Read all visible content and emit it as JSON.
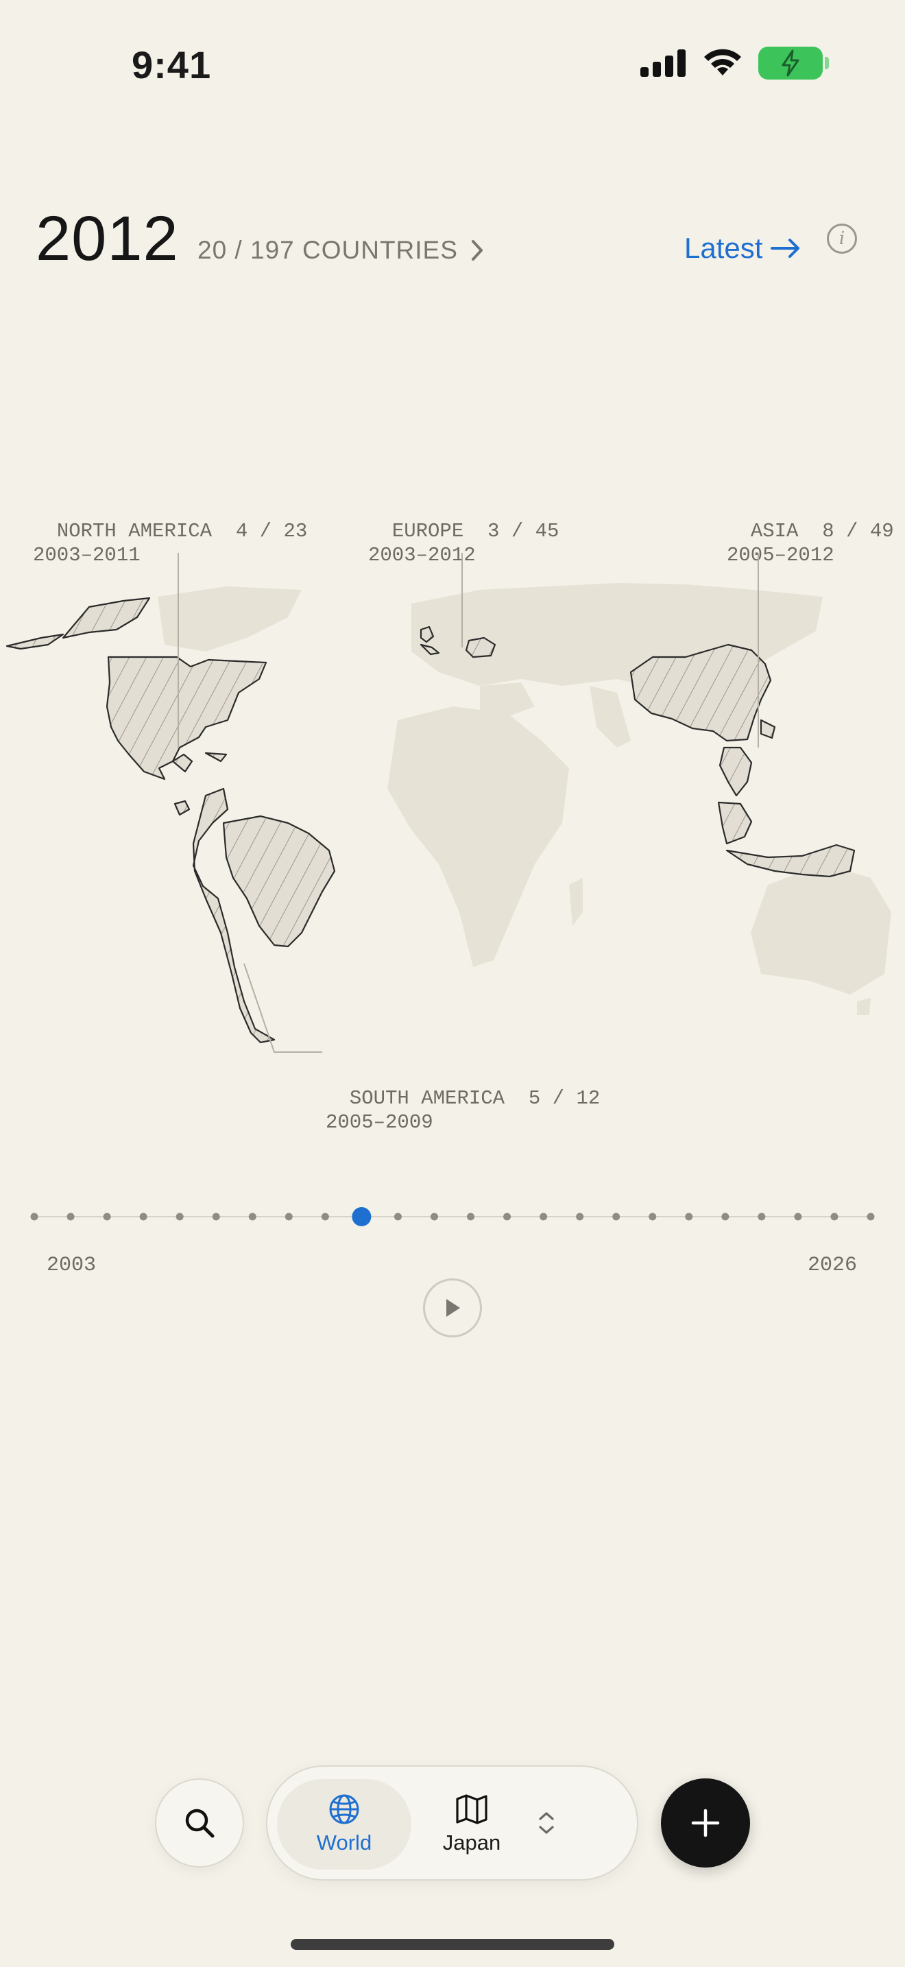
{
  "status": {
    "time": "9:41"
  },
  "header": {
    "year": "2012",
    "countries": "20 / 197 COUNTRIES",
    "latest_label": "Latest"
  },
  "regions": {
    "north_america": {
      "name": "NORTH AMERICA",
      "count": "4 / 23",
      "range": "2003–2011"
    },
    "europe": {
      "name": "EUROPE",
      "count": "3 / 45",
      "range": "2003–2012"
    },
    "asia": {
      "name": "ASIA",
      "count": "8 / 49",
      "range": "2005–2012"
    },
    "south_america": {
      "name": "SOUTH AMERICA",
      "count": "5 / 12",
      "range": "2005–2009"
    }
  },
  "timeline": {
    "start_label": "2003",
    "end_label": "2026",
    "start_year": 2003,
    "end_year": 2026,
    "selected_year": 2012,
    "accent": "#1e6fd0"
  },
  "tabbar": {
    "world_label": "World",
    "japan_label": "Japan",
    "search_icon": "search-icon",
    "add_icon": "plus-icon"
  },
  "colors": {
    "background": "#f4f1e8",
    "accent": "#1e6fd0",
    "land": "#e6e2d6"
  }
}
